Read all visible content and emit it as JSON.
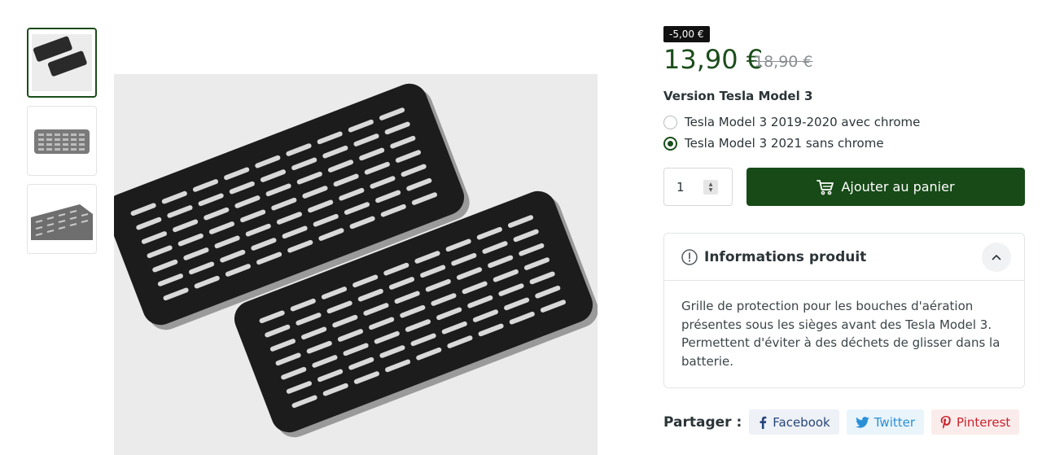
{
  "product": {
    "discount_badge": "-5,00 €",
    "price": "13,90 €",
    "old_price": "18,90 €",
    "variant_title": "Version Tesla Model 3",
    "variants": [
      {
        "label": "Tesla Model 3 2019-2020 avec chrome",
        "selected": false
      },
      {
        "label": "Tesla Model 3 2021 sans chrome",
        "selected": true
      }
    ],
    "quantity": "1",
    "add_to_cart_label": "Ajouter au panier"
  },
  "info": {
    "title": "Informations produit",
    "description": "Grille de protection pour les bouches d'aération présentes sous les sièges avant des Tesla Model 3. Permettent d'éviter à des déchets de glisser dans la batterie.",
    "expanded": true
  },
  "share": {
    "label": "Partager :",
    "buttons": [
      {
        "label": "Facebook",
        "icon": "facebook-icon",
        "color": "#27457a"
      },
      {
        "label": "Twitter",
        "icon": "twitter-icon",
        "color": "#2a90d6"
      },
      {
        "label": "Pinterest",
        "icon": "pinterest-icon",
        "color": "#c8232c"
      }
    ]
  },
  "gallery": {
    "thumbnails": [
      "thumbnail-1",
      "thumbnail-2",
      "thumbnail-3"
    ],
    "active_index": 0
  },
  "colors": {
    "accent": "#174a17",
    "price": "#1b4d1b",
    "badge": "#111111"
  }
}
